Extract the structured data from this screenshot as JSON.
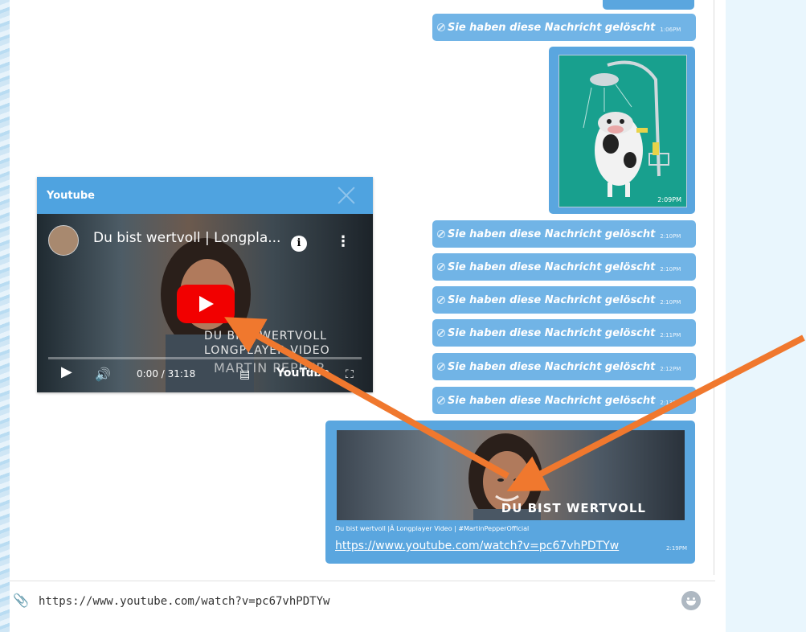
{
  "popup": {
    "title": "Youtube",
    "video_title": "Du bist wertvoll | Longpla...",
    "overlay_line1": "DU BIST WERTVOLL",
    "overlay_line2": "LONGPLAYER VIDEO",
    "overlay_line3": "MARTIN PEPPER",
    "time": "0:00 / 31:18",
    "brand": "YouTube"
  },
  "messages": {
    "deleted_text": "Sie haben diese Nachricht gelöscht",
    "deleted": [
      {
        "time": "1:06PM"
      },
      {
        "time": "2:10PM"
      },
      {
        "time": "2:10PM"
      },
      {
        "time": "2:10PM"
      },
      {
        "time": "2:11PM"
      },
      {
        "time": "2:12PM"
      },
      {
        "time": "2:13PM"
      }
    ],
    "image_time": "2:09PM",
    "youtube": {
      "thumb_title": "DU BIST WERTVOLL",
      "caption": "Du bist wertvoll |Â Longplayer Video | #MartinPepperOfficial",
      "link": "https://www.youtube.com/watch?v=pc67vhPDTYw",
      "time": "2:19PM"
    }
  },
  "composer": {
    "value": "https://www.youtube.com/watch?v=pc67vhPDTYw"
  },
  "colors": {
    "bubble": "#71b4e6",
    "popup_header": "#4fa3e0",
    "annotation_arrow": "#f0782e"
  }
}
